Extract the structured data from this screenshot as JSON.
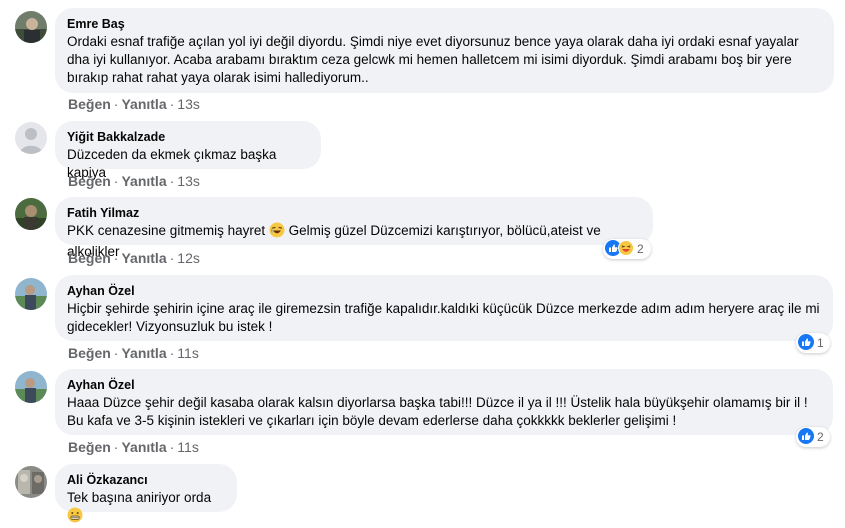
{
  "actions": {
    "like": "Beğen",
    "reply": "Yanıtla"
  },
  "comments": [
    {
      "author": "Emre Baş",
      "text": "Ordaki esnaf trafiğe açılan yol iyi değil diyordu. Şimdi niye evet diyorsunuz bence yaya olarak daha iyi ordaki esnaf yayalar dha iyi kullanıyor. Acaba arabamı bıraktım ceza gelcwk mi hemen halletcem mi isimi diyorduk. Şimdi arabamı boş bir yere bırakıp rahat rahat yaya olarak isimi hallediyorum..",
      "time": "13s"
    },
    {
      "author": "Yiğit Bakkalzade",
      "text": "Düzceden da ekmek çıkmaz başka kapiya",
      "time": "13s"
    },
    {
      "author": "Fatih Yilmaz",
      "text": "PKK cenazesine gitmemiş hayret",
      "text_after_emoji": "Gelmiş güzel Düzcemizi karıştırıyor, bölücü,ateist ve alkolikler",
      "time": "12s",
      "reaction_count": "2",
      "reaction_icons": [
        "like-icon",
        "haha-icon"
      ]
    },
    {
      "author": "Ayhan Özel",
      "text": "Hiçbir şehirde şehirin içine araç ile giremezsin trafiğe kapalıdır.kaldıki küçücük Düzce merkezde adım adım heryere araç ile mi gidecekler! Vizyonsuzluk bu istek !",
      "time": "11s",
      "reaction_count": "1",
      "reaction_icons": [
        "like-icon"
      ]
    },
    {
      "author": "Ayhan Özel",
      "text": "Haaa Düzce şehir değil kasaba olarak kalsın diyorlarsa başka tabi!!! Düzce il ya il !!! Üstelik hala büyükşehir olamamış bir il ! Bu kafa ve 3-5 kişinin istekleri ve çıkarları için böyle devam ederlerse daha çokkkkk beklerler gelişimi !",
      "time": "11s",
      "reaction_count": "2",
      "reaction_icons": [
        "like-icon"
      ]
    },
    {
      "author": "Ali Özkazancı",
      "text": "Tek başına aniriyor orda",
      "time": ""
    }
  ]
}
